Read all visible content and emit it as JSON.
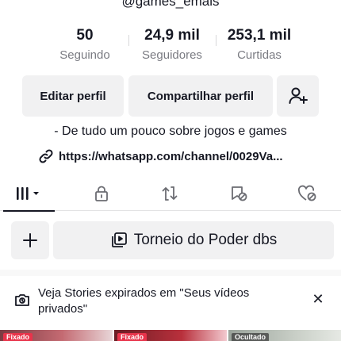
{
  "profile": {
    "username": "@games_emais",
    "stats": [
      {
        "value": "50",
        "label": "Seguindo"
      },
      {
        "value": "24,9 mil",
        "label": "Seguidores"
      },
      {
        "value": "253,1 mil",
        "label": "Curtidas"
      }
    ],
    "edit_label": "Editar perfil",
    "share_label": "Compartilhar perfil",
    "bio": "- De tudo um pouco sobre jogos e games",
    "link": "https://whatsapp.com/channel/0029Va..."
  },
  "tabs": [
    {
      "icon": "videos-grid-icon",
      "active": true
    },
    {
      "icon": "lock-icon"
    },
    {
      "icon": "repost-icon"
    },
    {
      "icon": "saved-icon"
    },
    {
      "icon": "liked-icon"
    }
  ],
  "playlist": {
    "title": "Torneio do Poder dbs"
  },
  "stories_notice": {
    "text": "Veja Stories expirados em \"Seus vídeos privados\""
  },
  "thumbnails": [
    {
      "badge": "Fixado"
    },
    {
      "badge": "Fixado"
    },
    {
      "badge": "Ocultado"
    }
  ],
  "colors": {
    "text": "#161823",
    "muted": "#7a7b82",
    "button_bg": "#f1f1f2",
    "badge_red": "#e8344b"
  }
}
